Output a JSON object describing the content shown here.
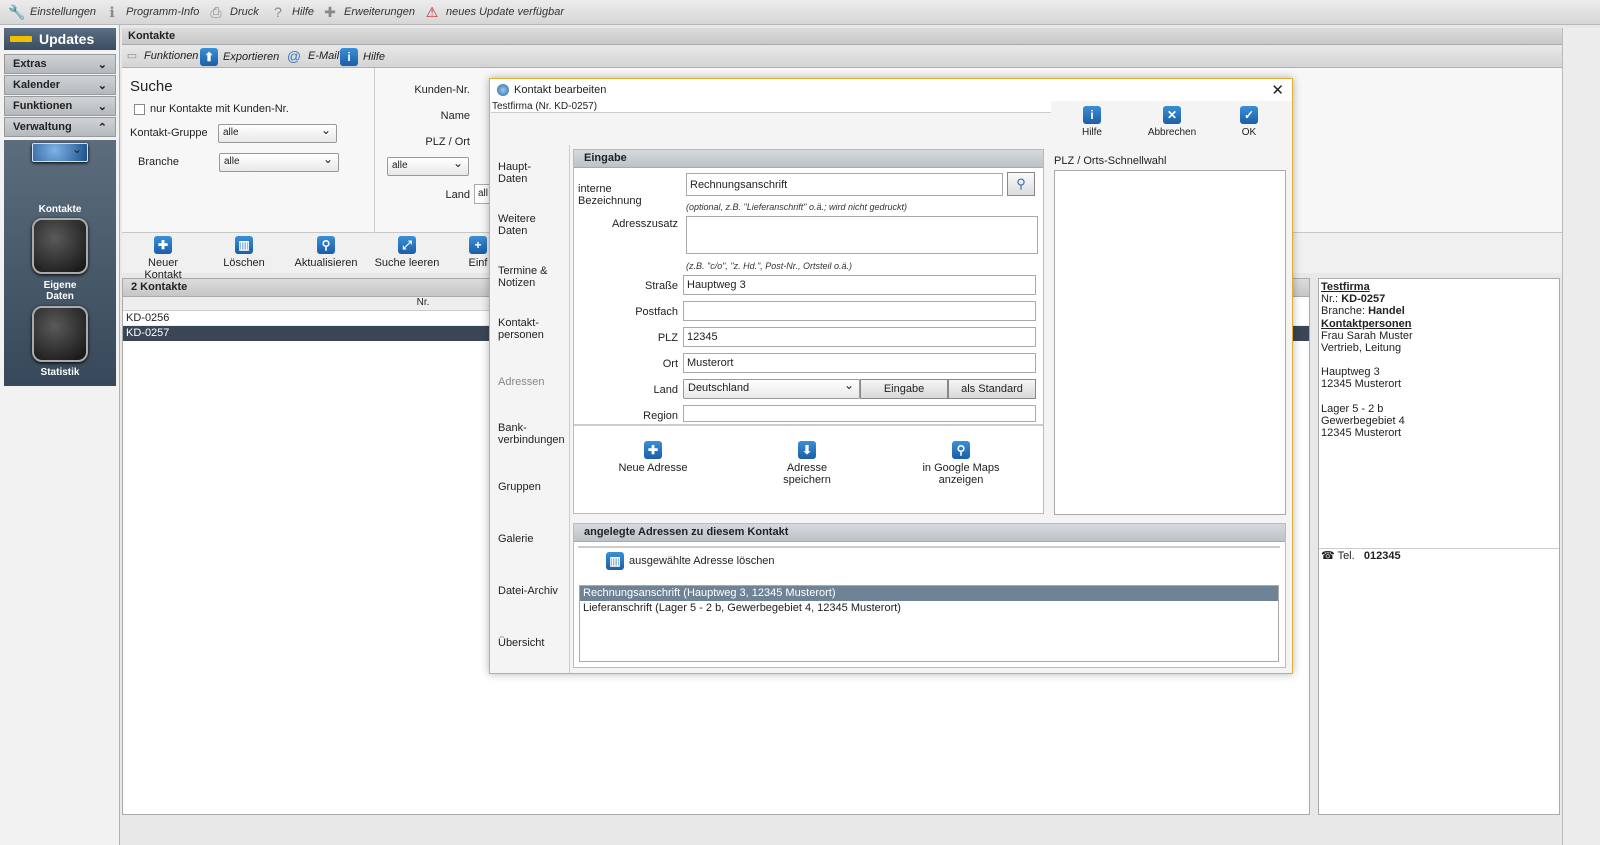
{
  "topbar": {
    "items": [
      {
        "label": "Einstellungen",
        "icon": "wrench-icon"
      },
      {
        "label": "Programm-Info",
        "icon": "info-icon"
      },
      {
        "label": "Druck",
        "icon": "printer-icon"
      },
      {
        "label": "Hilfe",
        "icon": "help-icon"
      },
      {
        "label": "Erweiterungen",
        "icon": "plus-icon"
      },
      {
        "label": "neues Update verfügbar",
        "icon": "warning-icon"
      }
    ]
  },
  "left": {
    "updates": "Updates",
    "accordion": [
      "Extras",
      "Kalender",
      "Funktionen",
      "Verwaltung"
    ],
    "nav": [
      {
        "label": "Kontakte"
      },
      {
        "label": "Eigene Daten"
      },
      {
        "label": "Statistik"
      }
    ]
  },
  "main": {
    "title": "Kontakte",
    "toolbar": [
      "Funktionen",
      "Exportieren",
      "E-Mail",
      "Hilfe"
    ],
    "search": {
      "title": "Suche",
      "only_with_number": "nur Kontakte mit Kunden-Nr.",
      "group_label": "Kontakt-Gruppe",
      "group_value": "alle",
      "branch_label": "Branche",
      "branch_value": "alle",
      "customer_no": "Kunden-Nr.",
      "name": "Name",
      "zip_city": "PLZ / Ort",
      "filter_value": "alle",
      "country": "Land",
      "country_value": "all"
    },
    "actions": [
      "Neuer Kontakt",
      "Löschen",
      "Aktualisieren",
      "Suche leeren",
      "Einf"
    ],
    "list": {
      "title": "2 Kontakte",
      "column": "Nr.",
      "rows": [
        "KD-0256",
        "KD-0257"
      ]
    }
  },
  "detail": {
    "company": "Testfirma",
    "nr_label": "Nr.:",
    "nr": "KD-0257",
    "branch_label": "Branche:",
    "branch": "Handel",
    "persons_title": "Kontaktpersonen",
    "person": "Frau Sarah Muster",
    "role": "Vertrieb, Leitung",
    "addr1_street": "Hauptweg 3",
    "addr1_city": "12345 Musterort",
    "addr2_street": "Lager 5 - 2 b",
    "addr2_extra": "Gewerbegebiet 4",
    "addr2_city": "12345 Musterort",
    "tel_label": "Tel.",
    "tel": "012345"
  },
  "dialog": {
    "title": "Kontakt bearbeiten",
    "subtitle": "Testfirma (Nr. KD-0257)",
    "top_buttons": [
      "Hilfe",
      "Abbrechen",
      "OK"
    ],
    "nav": [
      "Haupt-\nDaten",
      "Weitere\nDaten",
      "Termine &\nNotizen",
      "Kontakt-\npersonen",
      "Adressen",
      "Bank-\nverbindungen",
      "Gruppen",
      "Galerie",
      "Datei-Archiv",
      "Übersicht"
    ],
    "section_input": "Eingabe",
    "fields": {
      "internal_label": "interne Bezeichnung",
      "internal_value": "Rechnungsanschrift",
      "internal_hint": "(optional, z.B. \"Lieferanschrift\" o.ä.; wird nicht gedruckt)",
      "addon_label": "Adresszusatz",
      "addon_hint": "(z.B. \"c/o\", \"z. Hd.\", Post-Nr., Ortsteil o.ä.)",
      "street_label": "Straße",
      "street_value": "Hauptweg 3",
      "pobox_label": "Postfach",
      "zip_label": "PLZ",
      "zip_value": "12345",
      "city_label": "Ort",
      "city_value": "Musterort",
      "country_label": "Land",
      "country_value": "Deutschland",
      "country_btn1": "Eingabe",
      "country_btn2": "als Standard",
      "region_label": "Region"
    },
    "addr_actions": [
      "Neue Adresse",
      "Adresse speichern",
      "in Google Maps anzeigen"
    ],
    "quick_select": "PLZ / Orts-Schnellwahl",
    "saved_title": "angelegte Adressen zu diesem Kontakt",
    "delete_selected": "ausgewählte Adresse löschen",
    "saved_list": [
      "Rechnungsanschrift (Hauptweg 3, 12345 Musterort)",
      "Lieferanschrift (Lager 5 - 2 b, Gewerbegebiet 4, 12345 Musterort)"
    ]
  }
}
